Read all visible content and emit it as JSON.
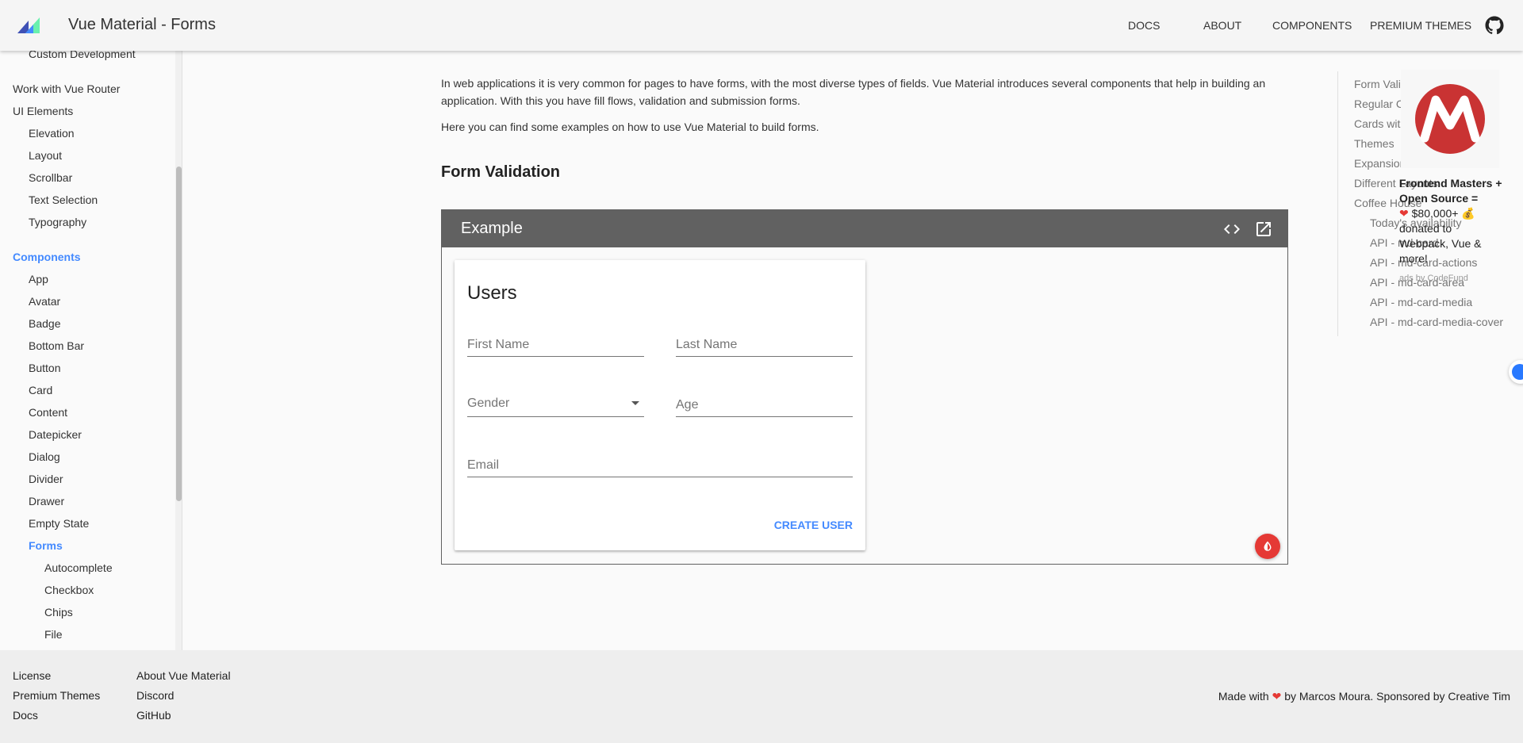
{
  "app": {
    "title": "Vue Material - Forms"
  },
  "nav": [
    "DOCS",
    "ABOUT",
    "COMPONENTS",
    "PREMIUM THEMES"
  ],
  "sidebar": {
    "items": [
      {
        "label": "Custom Development",
        "level": 2
      },
      {
        "label": "Work with Vue Router",
        "level": 1
      },
      {
        "label": "UI Elements",
        "level": 1
      },
      {
        "label": "Elevation",
        "level": 2
      },
      {
        "label": "Layout",
        "level": 2
      },
      {
        "label": "Scrollbar",
        "level": 2
      },
      {
        "label": "Text Selection",
        "level": 2
      },
      {
        "label": "Typography",
        "level": 2
      },
      {
        "label": "Components",
        "level": 1
      },
      {
        "label": "App",
        "level": 2
      },
      {
        "label": "Avatar",
        "level": 2
      },
      {
        "label": "Badge",
        "level": 2
      },
      {
        "label": "Bottom Bar",
        "level": 2
      },
      {
        "label": "Button",
        "level": 2
      },
      {
        "label": "Card",
        "level": 2
      },
      {
        "label": "Content",
        "level": 2
      },
      {
        "label": "Datepicker",
        "level": 2
      },
      {
        "label": "Dialog",
        "level": 2
      },
      {
        "label": "Divider",
        "level": 2
      },
      {
        "label": "Drawer",
        "level": 2
      },
      {
        "label": "Empty State",
        "level": 2
      },
      {
        "label": "Forms",
        "level": 2
      },
      {
        "label": "Autocomplete",
        "level": 3
      },
      {
        "label": "Checkbox",
        "level": 3
      },
      {
        "label": "Chips",
        "level": 3
      },
      {
        "label": "File",
        "level": 3
      }
    ]
  },
  "main": {
    "intro": "In web applications it is very common for pages to have forms, with the most diverse types of fields. Vue Material introduces several components that help in building an application. With this you have fill flows, validation and submission forms.",
    "intro2": "Here you can find some examples on how to use Vue Material to build forms.",
    "section_title": "Form Validation",
    "example": {
      "title": "Example",
      "card": {
        "title": "Users",
        "first_name": "First Name",
        "last_name": "Last Name",
        "gender": "Gender",
        "age": "Age",
        "email": "Email",
        "submit": "CREATE USER"
      }
    }
  },
  "toc": [
    {
      "label": "Form Validation",
      "level": 1
    },
    {
      "label": "Regular Cards",
      "level": 1
    },
    {
      "label": "Cards with Images",
      "level": 1
    },
    {
      "label": "Themes",
      "level": 1
    },
    {
      "label": "Expansion Control",
      "level": 1
    },
    {
      "label": "Different Layouts",
      "level": 1
    },
    {
      "label": "Coffee House",
      "level": 1
    },
    {
      "label": "Today's availability",
      "level": 2
    },
    {
      "label": "API - md-card",
      "level": 2
    },
    {
      "label": "API - md-card-actions",
      "level": 2
    },
    {
      "label": "API - md-card-area",
      "level": 2
    },
    {
      "label": "API - md-card-media",
      "level": 2
    },
    {
      "label": "API - md-card-media-cover",
      "level": 2
    }
  ],
  "ad": {
    "headline": "Frontend Masters + Open Source =",
    "amount": "$80,000+",
    "body": "donated to Webpack, Vue & more!",
    "by": "ads by CodeFund"
  },
  "footer": {
    "col1": [
      "License",
      "Premium Themes",
      "Docs"
    ],
    "col2": [
      "About Vue Material",
      "Discord",
      "GitHub"
    ],
    "made_prefix": "Made with",
    "made_suffix": "by Marcos Moura. Sponsored by Creative Tim"
  },
  "colors": {
    "accent": "#448aff",
    "header_bg": "#616161",
    "fab": "#e53935"
  }
}
